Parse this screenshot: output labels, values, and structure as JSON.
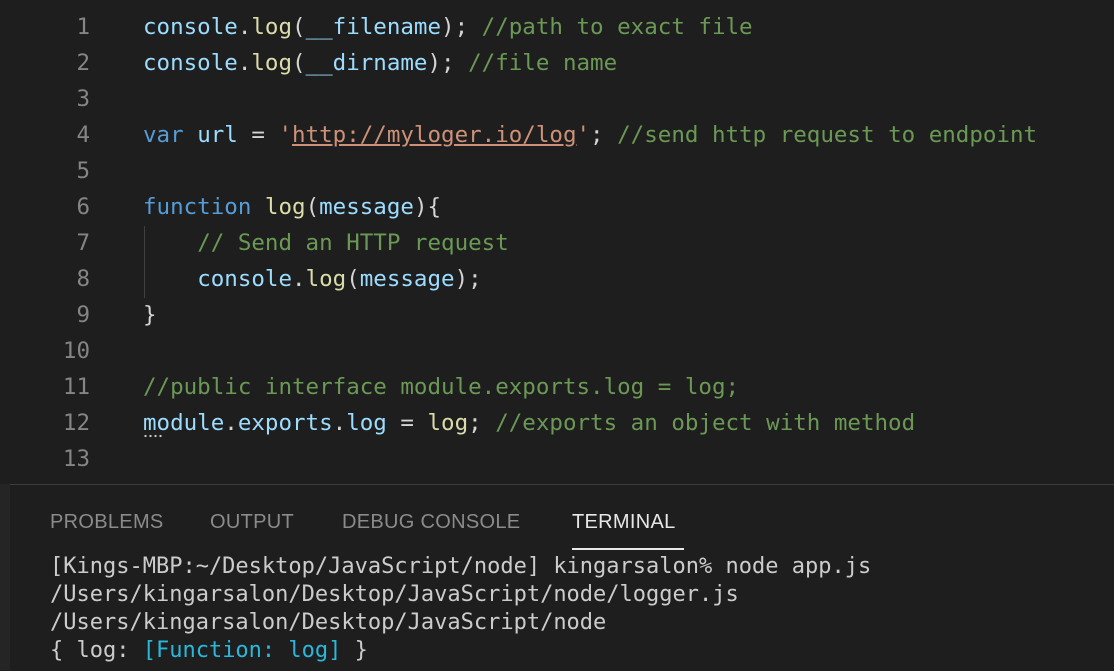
{
  "editor": {
    "lines": [
      {
        "num": "1",
        "tokens": [
          {
            "t": "console",
            "c": "t-var"
          },
          {
            "t": ".",
            "c": "t-pun"
          },
          {
            "t": "log",
            "c": "t-fn"
          },
          {
            "t": "(",
            "c": "t-pun"
          },
          {
            "t": "__filename",
            "c": "t-var"
          },
          {
            "t": "); ",
            "c": "t-pun"
          },
          {
            "t": "//path to exact file",
            "c": "t-com"
          }
        ]
      },
      {
        "num": "2",
        "tokens": [
          {
            "t": "console",
            "c": "t-var"
          },
          {
            "t": ".",
            "c": "t-pun"
          },
          {
            "t": "log",
            "c": "t-fn"
          },
          {
            "t": "(",
            "c": "t-pun"
          },
          {
            "t": "__dirname",
            "c": "t-var"
          },
          {
            "t": "); ",
            "c": "t-pun"
          },
          {
            "t": "//file name",
            "c": "t-com"
          }
        ]
      },
      {
        "num": "3",
        "tokens": []
      },
      {
        "num": "4",
        "tokens": [
          {
            "t": "var",
            "c": "t-kw"
          },
          {
            "t": " ",
            "c": "t-pun"
          },
          {
            "t": "url",
            "c": "t-var"
          },
          {
            "t": " = ",
            "c": "t-pun"
          },
          {
            "t": "'",
            "c": "t-str"
          },
          {
            "t": "http://myloger.io/log",
            "c": "t-url"
          },
          {
            "t": "'",
            "c": "t-str"
          },
          {
            "t": "; ",
            "c": "t-pun"
          },
          {
            "t": "//send http request to endpoint",
            "c": "t-com"
          }
        ]
      },
      {
        "num": "5",
        "tokens": []
      },
      {
        "num": "6",
        "tokens": [
          {
            "t": "function",
            "c": "t-kw"
          },
          {
            "t": " ",
            "c": "t-pun"
          },
          {
            "t": "log",
            "c": "t-fn"
          },
          {
            "t": "(",
            "c": "t-pun"
          },
          {
            "t": "message",
            "c": "t-var"
          },
          {
            "t": "){",
            "c": "t-pun"
          }
        ]
      },
      {
        "num": "7",
        "tokens": [
          {
            "t": "    ",
            "c": "t-pun"
          },
          {
            "t": "// Send an HTTP request",
            "c": "t-com"
          }
        ]
      },
      {
        "num": "8",
        "tokens": [
          {
            "t": "    ",
            "c": "t-pun"
          },
          {
            "t": "console",
            "c": "t-var"
          },
          {
            "t": ".",
            "c": "t-pun"
          },
          {
            "t": "log",
            "c": "t-fn"
          },
          {
            "t": "(",
            "c": "t-pun"
          },
          {
            "t": "message",
            "c": "t-var"
          },
          {
            "t": ");",
            "c": "t-pun"
          }
        ]
      },
      {
        "num": "9",
        "tokens": [
          {
            "t": "}",
            "c": "t-pun"
          }
        ]
      },
      {
        "num": "10",
        "tokens": []
      },
      {
        "num": "11",
        "tokens": [
          {
            "t": "//public interface module.exports.log = log;",
            "c": "t-com"
          }
        ]
      },
      {
        "num": "12",
        "tokens": [
          {
            "t": "module",
            "c": "t-var"
          },
          {
            "t": ".",
            "c": "t-pun"
          },
          {
            "t": "exports",
            "c": "t-prop"
          },
          {
            "t": ".",
            "c": "t-pun"
          },
          {
            "t": "log",
            "c": "t-prop"
          },
          {
            "t": " = ",
            "c": "t-pun"
          },
          {
            "t": "log",
            "c": "t-fn"
          },
          {
            "t": "; ",
            "c": "t-pun"
          },
          {
            "t": "//exports an object with method",
            "c": "t-com"
          }
        ]
      },
      {
        "num": "13",
        "tokens": []
      }
    ]
  },
  "panel": {
    "tabs": [
      {
        "label": "PROBLEMS",
        "active": false
      },
      {
        "label": "OUTPUT",
        "active": false
      },
      {
        "label": "DEBUG CONSOLE",
        "active": false
      },
      {
        "label": "TERMINAL",
        "active": true
      }
    ],
    "terminal": {
      "line1": "[Kings-MBP:~/Desktop/JavaScript/node] kingarsalon% node app.js",
      "line2": "/Users/kingarsalon/Desktop/JavaScript/node/logger.js",
      "line3": "/Users/kingarsalon/Desktop/JavaScript/node",
      "line4_pre": "{ log: ",
      "line4_fn": "[Function: log]",
      "line4_post": " }"
    }
  },
  "colors": {
    "background": "#1e1e1e",
    "keyword": "#569cd6",
    "function": "#dcdcaa",
    "variable": "#9cdcfe",
    "string": "#ce9178",
    "comment": "#6a9955",
    "terminal_function": "#29b8db"
  }
}
